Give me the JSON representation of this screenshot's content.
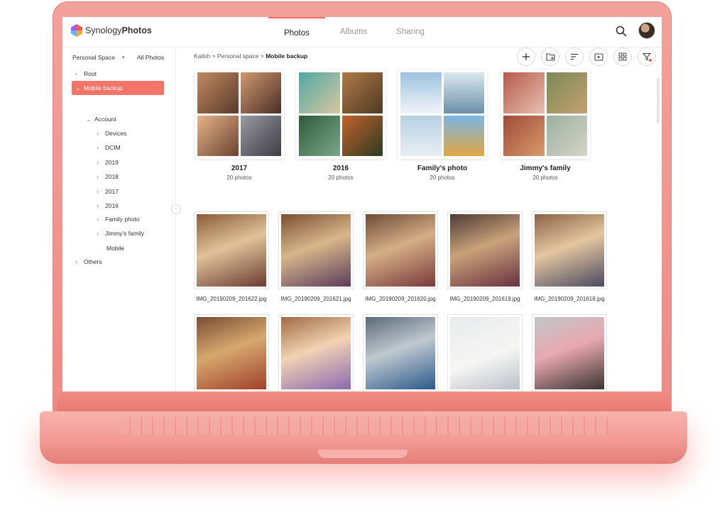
{
  "app": {
    "brand_light": "Synology",
    "brand_bold": "Photos",
    "accent_color": "#f3756a"
  },
  "header": {
    "tabs": [
      {
        "label": "Photos",
        "active": true
      },
      {
        "label": "Albums",
        "active": false
      },
      {
        "label": "Sharing",
        "active": false
      }
    ],
    "search_icon": "search-icon",
    "avatar_icon": "user-avatar"
  },
  "sidebar": {
    "space_selector": "Personal Space",
    "view_mode": "All Photos",
    "tree": [
      {
        "label": "Root",
        "icon": "chevron-right-icon"
      },
      {
        "label": "Mobile backup",
        "icon": "chevron-down-icon",
        "selected": true
      },
      {
        "label": "Account",
        "icon": "chevron-down-icon"
      },
      {
        "label": "Devices",
        "icon": "chevron-right-icon"
      },
      {
        "label": "DCIM",
        "icon": "chevron-right-icon"
      },
      {
        "label": "2019",
        "icon": "chevron-right-icon"
      },
      {
        "label": "2018",
        "icon": "chevron-right-icon"
      },
      {
        "label": "2017",
        "icon": "chevron-right-icon"
      },
      {
        "label": "2016",
        "icon": "chevron-right-icon"
      },
      {
        "label": "Family photo",
        "icon": "chevron-right-icon"
      },
      {
        "label": "Jimmy's family",
        "icon": "chevron-right-icon"
      },
      {
        "label": "Mobile",
        "icon": "none"
      },
      {
        "label": "Others",
        "icon": "chevron-right-icon"
      }
    ]
  },
  "breadcrumb": {
    "parts": [
      "Kailsh",
      "Personal space"
    ],
    "separator": ">",
    "current": "Mobile backup"
  },
  "toolbar": {
    "buttons": [
      "add-icon",
      "new-folder-icon",
      "sort-icon",
      "slideshow-icon",
      "grid-view-icon",
      "filter-icon"
    ]
  },
  "folders": [
    {
      "name": "2017",
      "count": "20 photos"
    },
    {
      "name": "2016",
      "count": "20 photos"
    },
    {
      "name": "Family's photo",
      "count": "20 photos"
    },
    {
      "name": "Jimmy's family",
      "count": "20 photos"
    }
  ],
  "photos": [
    {
      "name": "IMG_20190209_201622.jpg"
    },
    {
      "name": "IMG_20190209_201621.jpg"
    },
    {
      "name": "IMG_20190209_201620.jpg"
    },
    {
      "name": "IMG_20190209_201619.jpg"
    },
    {
      "name": "IMG_20190209_201618.jpg"
    },
    {
      "name": ""
    },
    {
      "name": ""
    },
    {
      "name": ""
    },
    {
      "name": ""
    },
    {
      "name": ""
    }
  ]
}
